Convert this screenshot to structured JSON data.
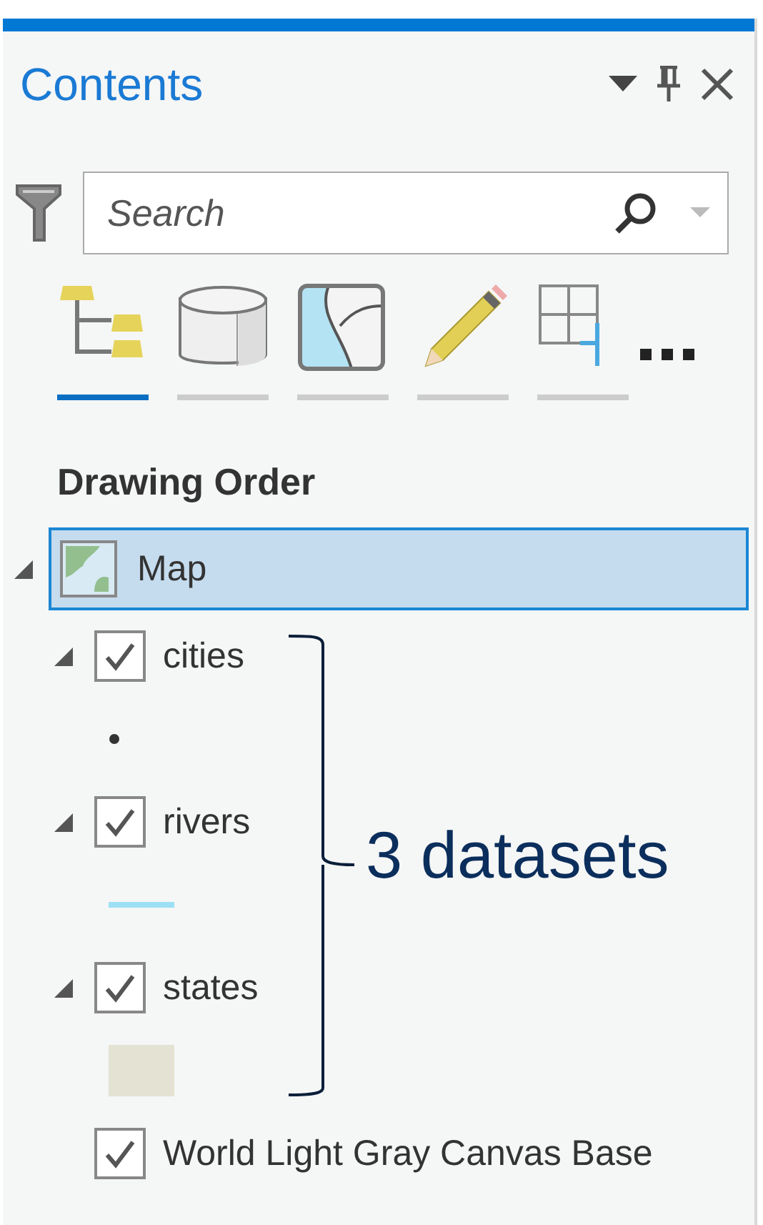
{
  "panel": {
    "title": "Contents"
  },
  "search": {
    "placeholder": "Search"
  },
  "view_tabs": [
    {
      "kind": "drawing-order",
      "selected": true
    },
    {
      "kind": "source",
      "selected": false
    },
    {
      "kind": "selection",
      "selected": false
    },
    {
      "kind": "editing",
      "selected": false
    },
    {
      "kind": "snapping",
      "selected": false
    }
  ],
  "heading": "Drawing Order",
  "map": {
    "label": "Map",
    "selected": true,
    "expanded": true
  },
  "layers": [
    {
      "kind": "layer",
      "name": "cities",
      "checked": true,
      "expanded": true,
      "symbol": {
        "kind": "point"
      }
    },
    {
      "kind": "layer",
      "name": "rivers",
      "checked": true,
      "expanded": true,
      "symbol": {
        "kind": "line"
      }
    },
    {
      "kind": "layer",
      "name": "states",
      "checked": true,
      "expanded": true,
      "symbol": {
        "kind": "polygon"
      }
    },
    {
      "kind": "basemap",
      "name": "World Light Gray Canvas Base",
      "checked": true
    }
  ],
  "annotation": {
    "text": "3 datasets"
  }
}
